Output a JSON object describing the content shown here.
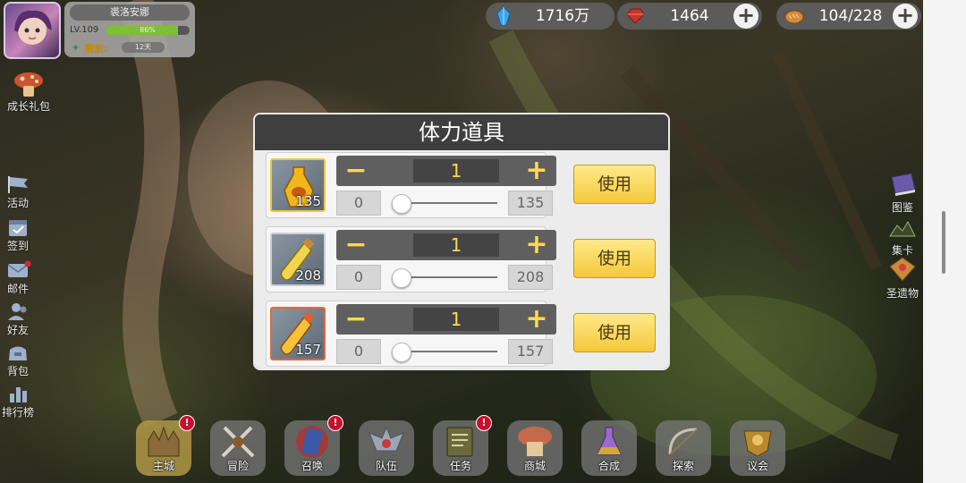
{
  "player": {
    "name": "裘洛安娜",
    "level": "LV.109",
    "exp_percent_text": "86%",
    "exp_fraction": 0.86,
    "remaining_label": "剩余:",
    "remaining_days": "12天"
  },
  "resources": [
    {
      "name": "crystal",
      "icon": "blue-crystal-icon",
      "value": "1716万",
      "has_plus": false
    },
    {
      "name": "gem",
      "icon": "red-gem-icon",
      "value": "1464",
      "has_plus": true
    },
    {
      "name": "stamina",
      "icon": "bread-icon",
      "value": "104/228",
      "has_plus": true
    }
  ],
  "growth_pack": {
    "label": "成长礼包",
    "icon": "gift-mushroom-icon"
  },
  "left_menu": [
    {
      "key": "activity",
      "label": "活动",
      "icon": "flag-icon"
    },
    {
      "key": "signin",
      "label": "签到",
      "icon": "calendar-icon"
    },
    {
      "key": "mail",
      "label": "邮件",
      "icon": "mail-icon",
      "dot": true
    },
    {
      "key": "friends",
      "label": "好友",
      "icon": "friends-icon"
    },
    {
      "key": "bag",
      "label": "背包",
      "icon": "bag-icon"
    },
    {
      "key": "ranking",
      "label": "排行榜",
      "icon": "ranking-icon"
    }
  ],
  "right_menu": [
    {
      "key": "codex",
      "label": "图鉴",
      "icon": "book-icon"
    },
    {
      "key": "cards",
      "label": "集卡",
      "icon": "cards-icon"
    },
    {
      "key": "relics",
      "label": "圣遗物",
      "icon": "relic-icon"
    }
  ],
  "dialog": {
    "title": "体力道具",
    "items": [
      {
        "icon": "gold-potion-icon",
        "count": "135",
        "quantity": "1",
        "min": "0",
        "max": "135",
        "use_label": "使用",
        "minus": "−",
        "plus": "+"
      },
      {
        "icon": "yellow-vial-icon",
        "count": "208",
        "quantity": "1",
        "min": "0",
        "max": "208",
        "use_label": "使用",
        "minus": "−",
        "plus": "+"
      },
      {
        "icon": "orange-vial-icon",
        "count": "157",
        "quantity": "1",
        "min": "0",
        "max": "157",
        "use_label": "使用",
        "minus": "−",
        "plus": "+"
      }
    ]
  },
  "bottom_nav": [
    {
      "key": "main",
      "label": "主城",
      "icon": "castle-icon",
      "active": true,
      "badge": "!"
    },
    {
      "key": "adventure",
      "label": "冒险",
      "icon": "crossed-swords-icon",
      "active": false,
      "badge": ""
    },
    {
      "key": "summon",
      "label": "召唤",
      "icon": "summon-card-icon",
      "active": false,
      "badge": "!"
    },
    {
      "key": "team",
      "label": "队伍",
      "icon": "team-crest-icon",
      "active": false,
      "badge": ""
    },
    {
      "key": "quest",
      "label": "任务",
      "icon": "quest-book-icon",
      "active": false,
      "badge": "!"
    },
    {
      "key": "shop",
      "label": "商城",
      "icon": "shop-icon",
      "active": false,
      "badge": ""
    },
    {
      "key": "synthesis",
      "label": "合成",
      "icon": "flask-icon",
      "active": false,
      "badge": ""
    },
    {
      "key": "explore",
      "label": "探索",
      "icon": "explore-bow-icon",
      "active": false,
      "badge": ""
    },
    {
      "key": "council",
      "label": "议会",
      "icon": "council-crest-icon",
      "active": false,
      "badge": ""
    }
  ],
  "colors": {
    "accent_gold": "#f4c93a",
    "badge_red": "#c8102e",
    "qty_yellow": "#ffd94a"
  }
}
